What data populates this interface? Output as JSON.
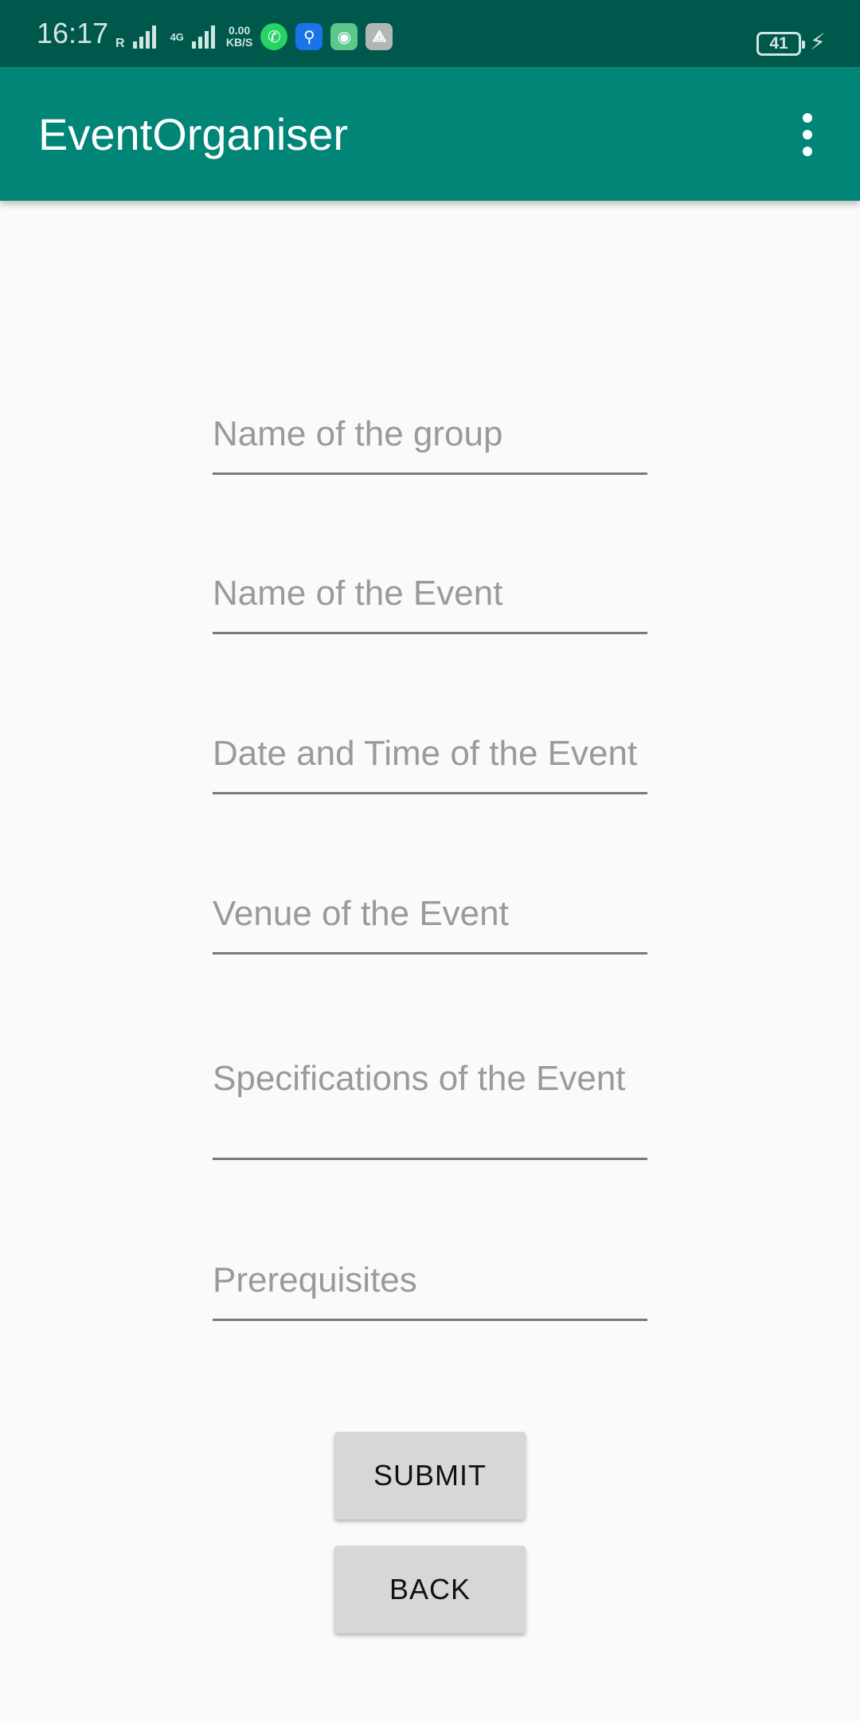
{
  "status_bar": {
    "time": "16:17",
    "signal_label": "R",
    "network_type": "4G",
    "speed_value": "0.00",
    "speed_unit": "KB/S",
    "battery_level": "41",
    "icons": [
      "whatsapp-icon",
      "usb-icon",
      "app-icon",
      "share-icon"
    ],
    "colors": {
      "whatsapp": "#25d366",
      "usb": "#1a73e8",
      "app": "#5cc78a",
      "share": "#b0b8b6"
    }
  },
  "app_bar": {
    "title": "EventOrganiser",
    "color": "#008577"
  },
  "form": {
    "group_name": {
      "placeholder": "Name of the group",
      "value": ""
    },
    "event_name": {
      "placeholder": "Name of the Event",
      "value": ""
    },
    "date_time": {
      "placeholder": "Date and Time of the Event",
      "value": ""
    },
    "venue": {
      "placeholder": "Venue of the Event",
      "value": ""
    },
    "specifications": {
      "placeholder": "Specifications of the Event",
      "value": ""
    },
    "prerequisites": {
      "placeholder": "Prerequisites",
      "value": ""
    }
  },
  "buttons": {
    "submit_label": "SUBMIT",
    "back_label": "BACK"
  }
}
